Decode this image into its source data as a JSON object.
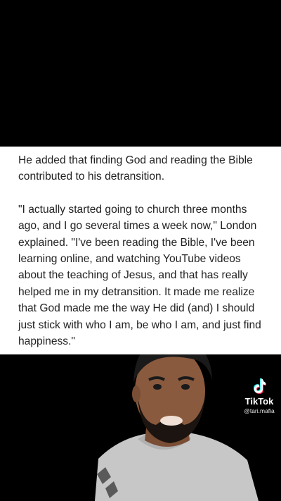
{
  "article": {
    "paragraph1": "He added that finding God and reading the Bible contributed to his detransition.",
    "paragraph2": "\"I actually started going to church three months ago, and I go several times a week now,\" London explained. \"I've been reading the Bible, I've been learning online, and watching YouTube videos about the teaching of Jesus, and that has really helped me in my detransition. It made me realize that God made me the way He did (and) I should just stick with who I am, be who I am, and just find happiness.\""
  },
  "watermark": {
    "app_name": "TikTok",
    "handle": "@tari.mafia",
    "icon": "tiktok-logo-icon"
  },
  "colors": {
    "background": "#000000",
    "card": "#ffffff",
    "text": "#222222",
    "shirt": "#c9c9c9",
    "skin": "#8a5a3e"
  }
}
